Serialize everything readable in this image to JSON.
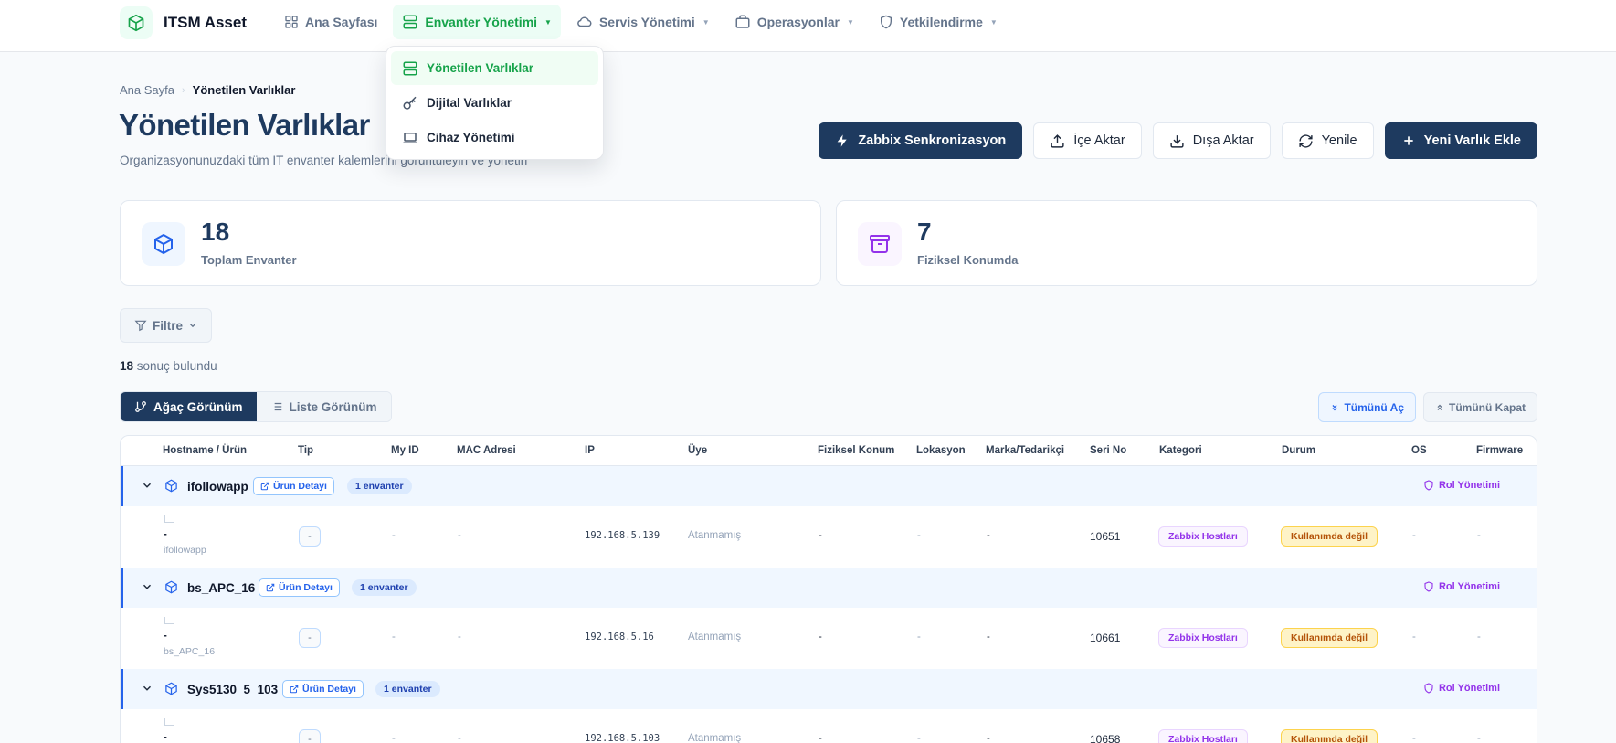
{
  "app": {
    "title": "ITSM Asset",
    "accent": "#16a34a",
    "primary": "#1e3a5f"
  },
  "nav": {
    "items": [
      {
        "label": "Ana Sayfası",
        "icon": "grid-icon"
      },
      {
        "label": "Envanter Yönetimi",
        "icon": "server-icon",
        "active": true
      },
      {
        "label": "Servis Yönetimi",
        "icon": "cloud-icon"
      },
      {
        "label": "Operasyonlar",
        "icon": "briefcase-icon"
      },
      {
        "label": "Yetkilendirme",
        "icon": "shield-icon"
      }
    ]
  },
  "dropdown": {
    "items": [
      {
        "label": "Yönetilen Varlıklar",
        "icon": "server-icon",
        "active": true
      },
      {
        "label": "Dijital Varlıklar",
        "icon": "key-icon"
      },
      {
        "label": "Cihaz Yönetimi",
        "icon": "laptop-icon"
      }
    ]
  },
  "breadcrumb": {
    "home": "Ana Sayfa",
    "sep": "›",
    "current": "Yönetilen Varlıklar"
  },
  "page": {
    "title": "Yönetilen Varlıklar",
    "subtitle": "Organizasyonunuzdaki tüm IT envanter kalemlerini görüntüleyin ve yönetin"
  },
  "actions": {
    "zabbix": "Zabbix Senkronizasyon",
    "import": "İçe Aktar",
    "export": "Dışa Aktar",
    "refresh": "Yenile",
    "add": "Yeni Varlık Ekle"
  },
  "stats": [
    {
      "value": "18",
      "label": "Toplam Envanter",
      "color": "#2563eb"
    },
    {
      "value": "7",
      "label": "Fiziksel Konumda",
      "color": "#9333ea"
    }
  ],
  "filter": {
    "label": "Filtre"
  },
  "results": {
    "count": "18",
    "text": " sonuç bulundu"
  },
  "views": {
    "tree": "Ağaç Görünüm",
    "list": "Liste Görünüm"
  },
  "expand": {
    "open_all": "Tümünü Aç",
    "close_all": "Tümünü Kapat"
  },
  "table": {
    "headers": [
      "Hostname / Ürün",
      "Tip",
      "My ID",
      "MAC Adresi",
      "IP",
      "Üye",
      "Fiziksel Konum",
      "Lokasyon",
      "Marka/Tedarikçi",
      "Seri No",
      "Kategori",
      "Durum",
      "OS",
      "Firmware"
    ],
    "product_detail": "Ürün Detayı",
    "role_label": "Rol Yönetimi",
    "groups": [
      {
        "name": "ifollowapp",
        "count_label": "1 envanter",
        "row": {
          "hostname": "-",
          "sub": "ifollowapp",
          "tip": "-",
          "myid": "-",
          "mac": "-",
          "ip": "192.168.5.139",
          "uye": "Atanmamış",
          "fiziksel": "-",
          "lokasyon": "-",
          "marka": "-",
          "seri": "10651",
          "kategori": "Zabbix Hostları",
          "durum": "Kullanımda değil",
          "os": "-",
          "firmware": "-"
        }
      },
      {
        "name": "bs_APC_16",
        "count_label": "1 envanter",
        "row": {
          "hostname": "-",
          "sub": "bs_APC_16",
          "tip": "-",
          "myid": "-",
          "mac": "-",
          "ip": "192.168.5.16",
          "uye": "Atanmamış",
          "fiziksel": "-",
          "lokasyon": "-",
          "marka": "-",
          "seri": "10661",
          "kategori": "Zabbix Hostları",
          "durum": "Kullanımda değil",
          "os": "-",
          "firmware": "-"
        }
      },
      {
        "name": "Sys5130_5_103",
        "count_label": "1 envanter",
        "row": {
          "hostname": "-",
          "sub": "",
          "tip": "-",
          "myid": "-",
          "mac": "-",
          "ip": "192.168.5.103",
          "uye": "Atanmamış",
          "fiziksel": "-",
          "lokasyon": "-",
          "marka": "-",
          "seri": "10658",
          "kategori": "Zabbix Hostları",
          "durum": "Kullanımda değil",
          "os": "-",
          "firmware": "-"
        }
      }
    ]
  }
}
